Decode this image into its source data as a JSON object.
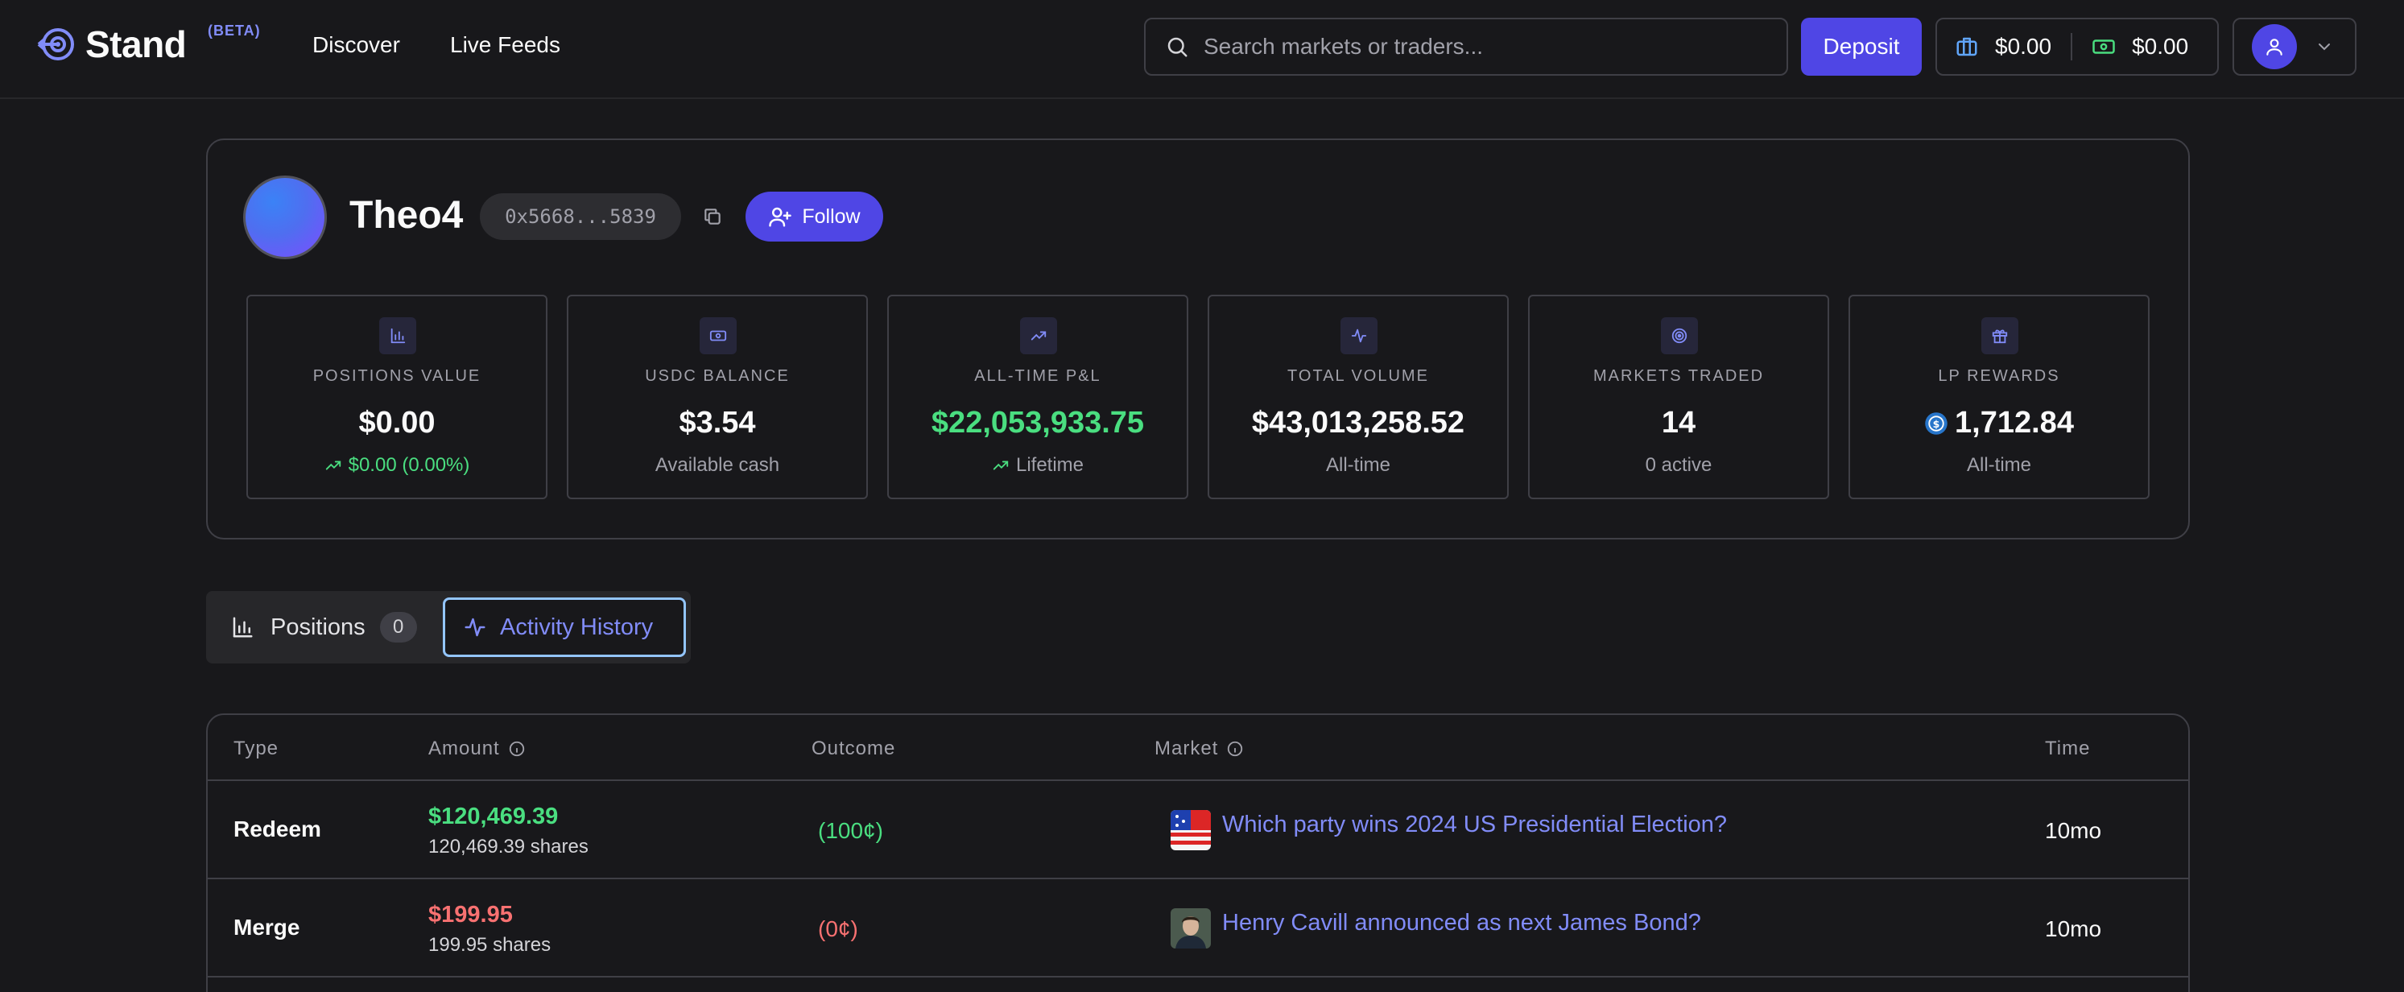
{
  "header": {
    "brand": "Stand",
    "beta_label": "(BETA)",
    "nav": [
      "Discover",
      "Live Feeds"
    ],
    "search_placeholder": "Search markets or traders...",
    "deposit_label": "Deposit",
    "portfolio_balance": "$0.00",
    "cash_balance": "$0.00"
  },
  "profile": {
    "name": "Theo4",
    "address": "0x5668...5839",
    "follow_label": "Follow"
  },
  "stats": [
    {
      "label": "POSITIONS VALUE",
      "value": "$0.00",
      "sub": "$0.00 (0.00%)",
      "icon": "bar-chart-icon"
    },
    {
      "label": "USDC BALANCE",
      "value": "$3.54",
      "sub": "Available cash",
      "icon": "banknote-icon"
    },
    {
      "label": "ALL-TIME P&L",
      "value": "$22,053,933.75",
      "sub": "Lifetime",
      "icon": "trending-up-icon"
    },
    {
      "label": "TOTAL VOLUME",
      "value": "$43,013,258.52",
      "sub": "All-time",
      "icon": "activity-icon"
    },
    {
      "label": "MARKETS TRADED",
      "value": "14",
      "sub": "0 active",
      "icon": "target-icon"
    },
    {
      "label": "LP REWARDS",
      "value": "1,712.84",
      "sub": "All-time",
      "icon": "gift-icon"
    }
  ],
  "tabs": {
    "positions_label": "Positions",
    "positions_count": "0",
    "activity_label": "Activity History"
  },
  "table": {
    "columns": [
      "Type",
      "Amount",
      "Outcome",
      "Market",
      "Time"
    ],
    "rows": [
      {
        "type": "Redeem",
        "amount": "$120,469.39",
        "shares": "120,469.39 shares",
        "outcome": "(100¢)",
        "market": "Which party wins 2024 US Presidential Election?",
        "time": "10mo"
      },
      {
        "type": "Merge",
        "amount": "$199.95",
        "shares": "199.95 shares",
        "outcome": "(0¢)",
        "market": "Henry Cavill announced as next James Bond?",
        "time": "10mo"
      }
    ]
  },
  "colors": {
    "accent": "#4f46e5",
    "link": "#818cf8",
    "positive": "#4ade80",
    "negative": "#f87171",
    "background": "#18181b",
    "border": "#3f3f46"
  }
}
